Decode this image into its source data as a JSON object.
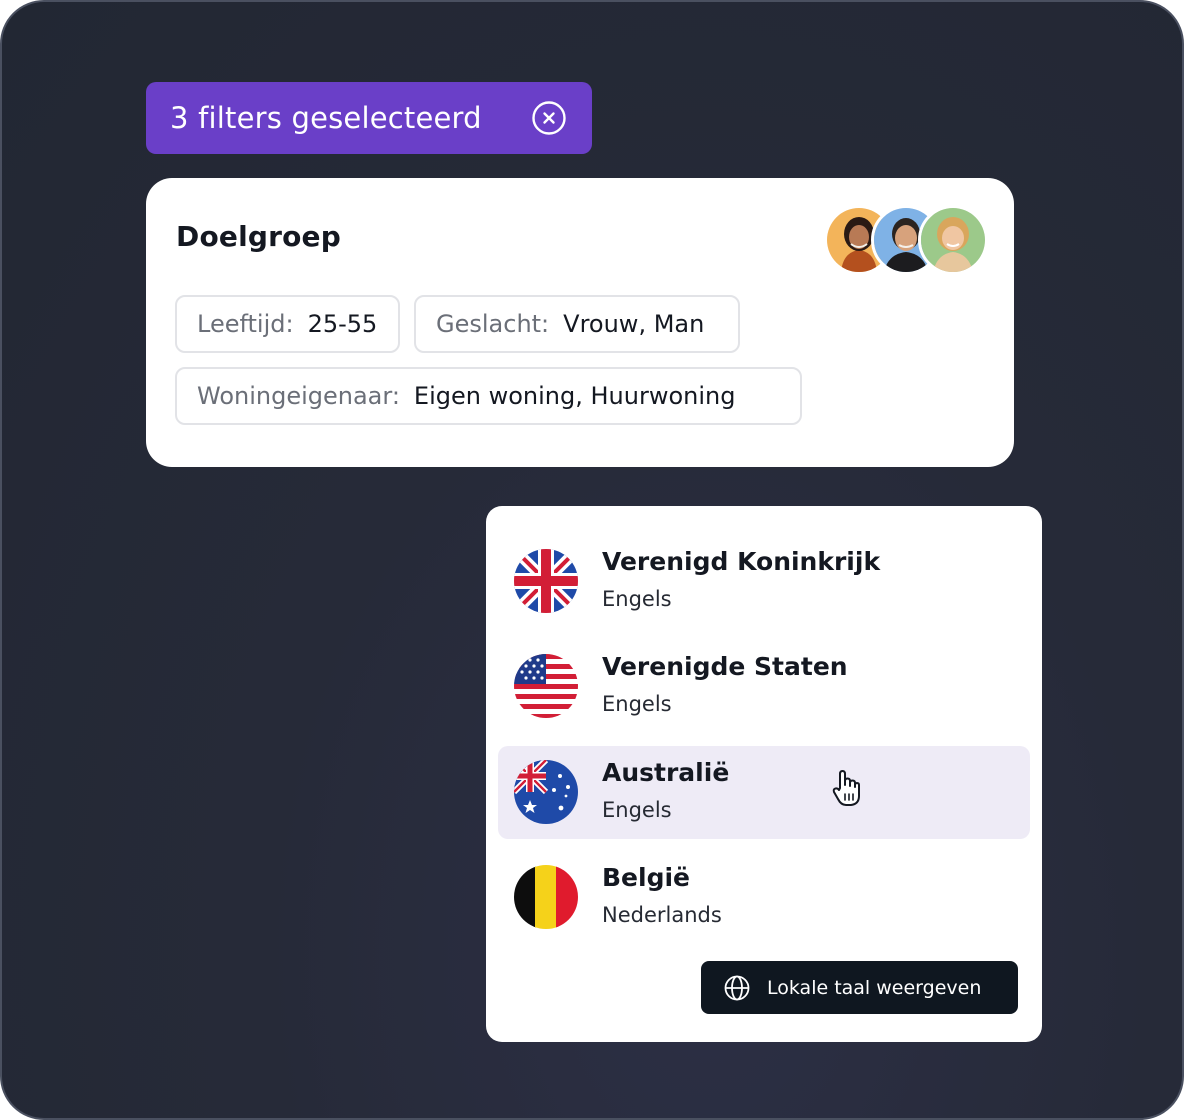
{
  "filters": {
    "label": "3 filters geselecteerd",
    "close_icon": "close-circle-icon",
    "color": "#6a3fc8"
  },
  "audience": {
    "title": "Doelgroep",
    "avatars": [
      "avatar-woman-orange",
      "avatar-man-blue",
      "avatar-woman-green"
    ],
    "tags": [
      {
        "key": "Leeftijd:",
        "value": "25-55"
      },
      {
        "key": "Geslacht:",
        "value": "Vrouw, Man"
      },
      {
        "key": "Woningeigenaar:",
        "value": "Eigen woning, Huurwoning"
      }
    ]
  },
  "languages": {
    "items": [
      {
        "country": "Verenigd Koninkrijk",
        "language": "Engels",
        "flag": "uk-flag-icon"
      },
      {
        "country": "Verenigde Staten",
        "language": "Engels",
        "flag": "us-flag-icon"
      },
      {
        "country": "Australië",
        "language": "Engels",
        "flag": "au-flag-icon",
        "hovered": true
      },
      {
        "country": "België",
        "language": "Nederlands",
        "flag": "be-flag-icon"
      }
    ],
    "local_button": "Lokale taal weergeven",
    "local_button_icon": "globe-icon",
    "hover_color": "#eeebf6"
  }
}
